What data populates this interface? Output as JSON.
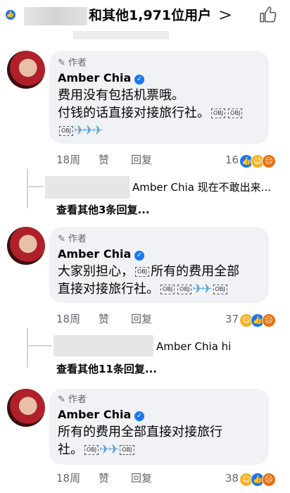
{
  "header": {
    "text": "和其他1,971位用户",
    "chevron": ">",
    "like_icon": "like-icon",
    "thumb_icon": "thumb-up-icon"
  },
  "comments": [
    {
      "author_tag": "作者",
      "name": "Amber Chia",
      "lines": [
        "费用没有包括机票哦。",
        "付钱的话直接对接旅行社。"
      ],
      "time": "18周",
      "like_label": "赞",
      "reply_label": "回复",
      "reaction_count": "16",
      "reply_preview": "Amber Chia 现在不敢出来...",
      "more_replies": "查看其他3条回复..."
    },
    {
      "author_tag": "作者",
      "name": "Amber Chia",
      "lines": [
        "大家别担心，",
        "所有的费用全部",
        "直接对接旅行社。"
      ],
      "time": "18周",
      "like_label": "赞",
      "reply_label": "回复",
      "reaction_count": "37",
      "reply_preview": "Amber Chia hi",
      "more_replies": "查看其他11条回复..."
    },
    {
      "author_tag": "作者",
      "name": "Amber Chia",
      "lines": [
        "所有的费用全部直接对接旅行",
        "社。"
      ],
      "time": "18周",
      "like_label": "赞",
      "reply_label": "回复",
      "reaction_count": "38"
    }
  ],
  "obj_label": "OBJ",
  "plane_glyph": "✈",
  "colors": {
    "accent": "#1877f2",
    "bubble": "#f0f2f5",
    "muted": "#65676b"
  }
}
